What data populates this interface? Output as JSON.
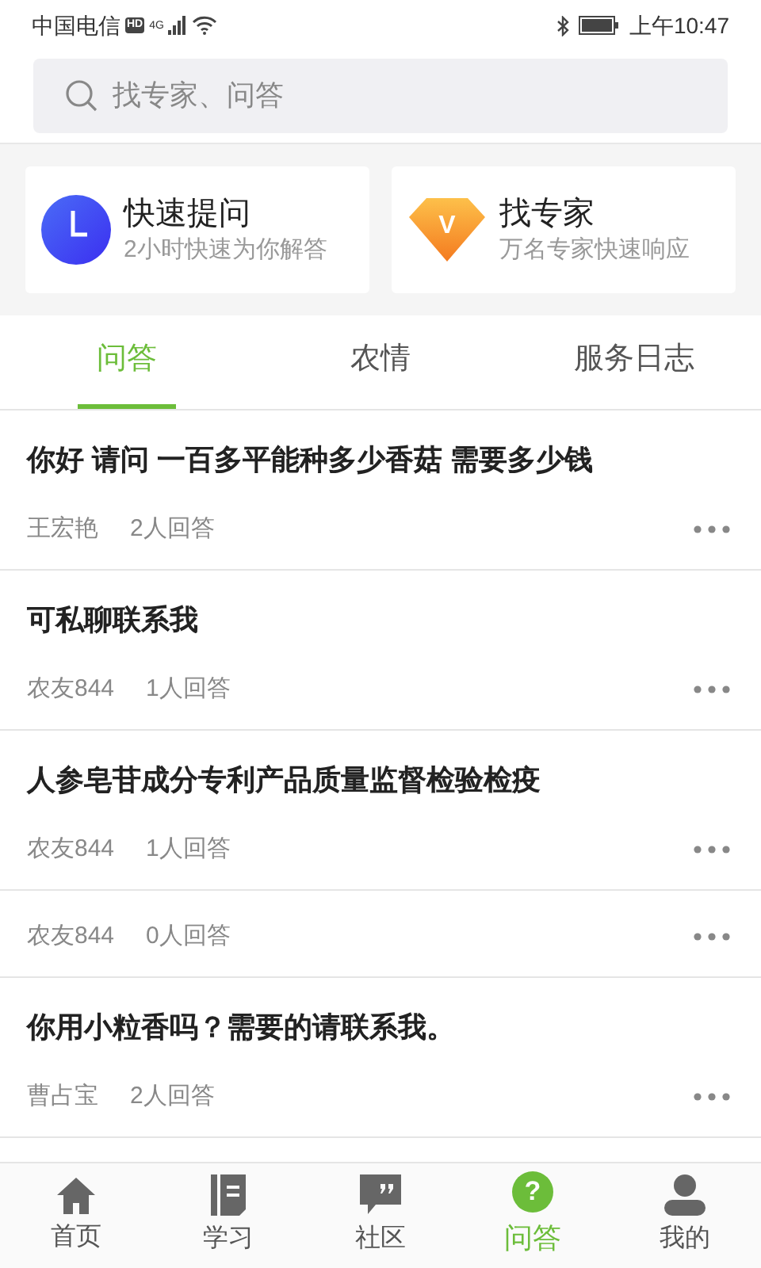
{
  "status_bar": {
    "carrier": "中国电信",
    "hd": "HD",
    "network": "4G",
    "time": "上午10:47"
  },
  "search": {
    "placeholder": "找专家、问答"
  },
  "shortcuts": [
    {
      "kind": "clock",
      "title": "快速提问",
      "subtitle": "2小时快速为你解答"
    },
    {
      "kind": "diamond",
      "badge": "V",
      "title": "找专家",
      "subtitle": "万名专家快速响应"
    }
  ],
  "tabs": [
    {
      "label": "问答",
      "selected": true
    },
    {
      "label": "农情",
      "selected": false
    },
    {
      "label": "服务日志",
      "selected": false
    }
  ],
  "questions": [
    {
      "title": "你好 请问 一百多平能种多少香菇 需要多少钱",
      "author": "王宏艳",
      "answers": "2人回答"
    },
    {
      "title": "可私聊联系我",
      "author": "农友844",
      "answers": "1人回答"
    },
    {
      "title": "人参皂苷成分专利产品质量监督检验检疫",
      "author": "农友844",
      "answers": "1人回答"
    },
    {
      "author": "农友844",
      "answers": "0人回答"
    },
    {
      "title": "你用小粒香吗？需要的请联系我。",
      "author": "曹占宝",
      "answers": "2人回答"
    }
  ],
  "nav": [
    {
      "kind": "home",
      "label": "首页",
      "selected": false
    },
    {
      "kind": "book",
      "label": "学习",
      "selected": false
    },
    {
      "kind": "chat",
      "label": "社区",
      "selected": false
    },
    {
      "kind": "help",
      "glyph": "?",
      "label": "问答",
      "selected": true
    },
    {
      "kind": "user",
      "label": "我的",
      "selected": false
    }
  ]
}
